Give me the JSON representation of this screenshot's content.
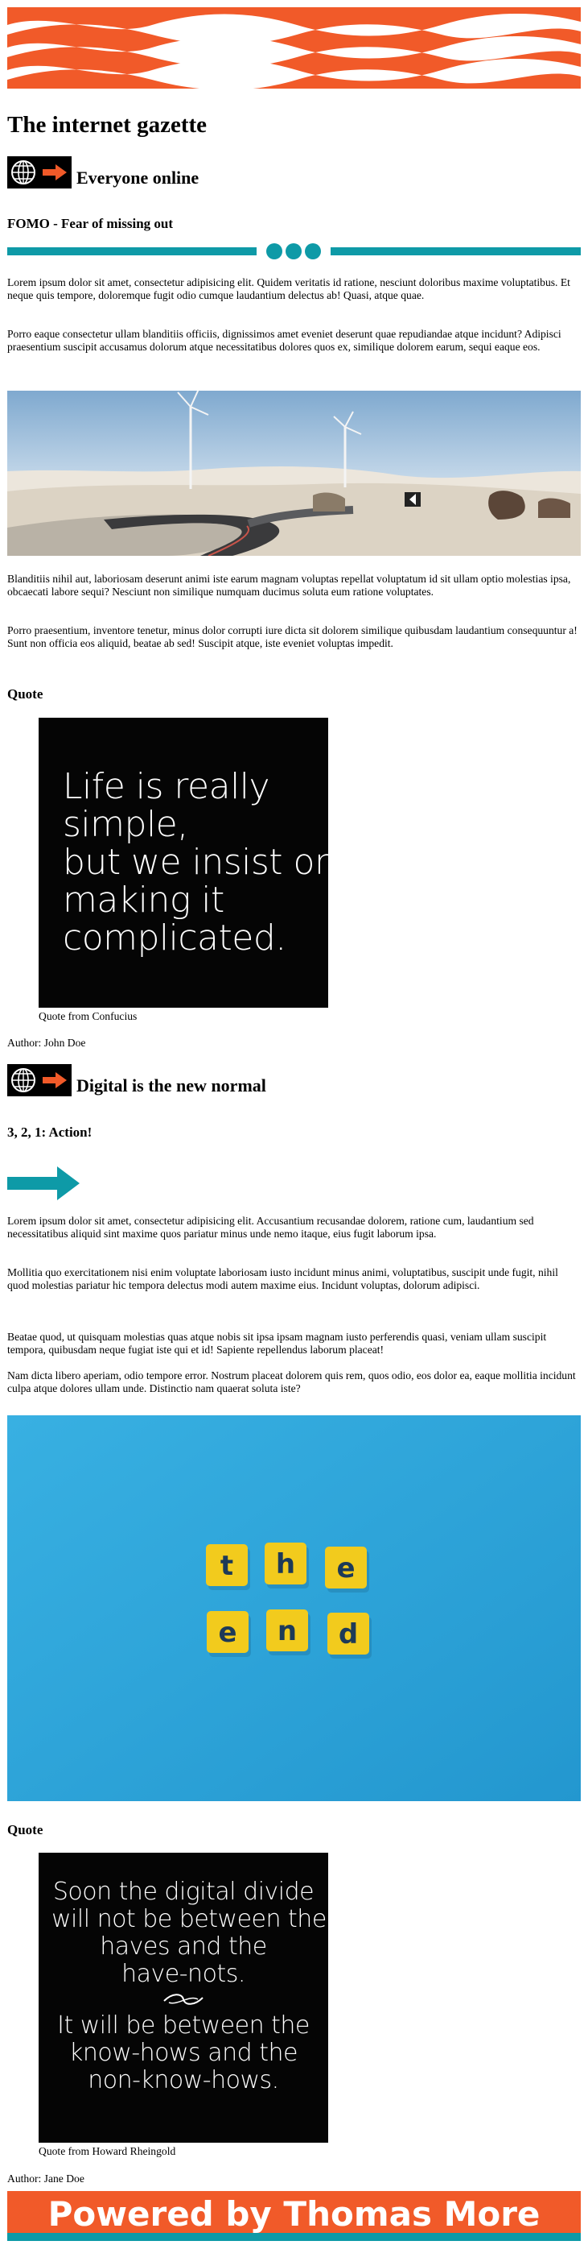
{
  "site": {
    "title": "The internet gazette"
  },
  "colors": {
    "accent_orange": "#f15a29",
    "accent_teal": "#0e9aa7"
  },
  "sections": [
    {
      "icon": "globe-arrow-icon",
      "title": "Everyone online",
      "subtitle": "FOMO - Fear of missing out",
      "paragraphs_before": [
        "Lorem ipsum dolor sit amet, consectetur adipisicing elit. Quidem veritatis id ratione, nesciunt doloribus maxime voluptatibus. Et neque quis tempore, doloremque fugit odio cumque laudantium delectus ab! Quasi, atque quae.",
        "Porro eaque consectetur ullam blanditiis officiis, dignissimos amet eveniet deserunt quae repudiandae atque incidunt? Adipisci praesentium suscipit accusamus dolorum atque necessitatibus dolores quos ex, similique dolorem earum, sequi eaque eos."
      ],
      "paragraphs_after": [
        "Blanditiis nihil aut, laboriosam deserunt animi iste earum magnam voluptas repellat voluptatum id sit ullam optio molestias ipsa, obcaecati labore sequi? Nesciunt non similique numquam ducimus soluta eum ratione voluptates.",
        "Porro praesentium, inventore tenetur, minus dolor corrupti iure dicta sit dolorem similique quibusdam laudantium consequuntur a! Sunt non officia eos aliquid, beatae ab sed! Suscipit atque, iste eveniet voluptas impedit."
      ],
      "quote": {
        "heading": "Quote",
        "lines": [
          "Life is really",
          "simple,",
          "but we insist on",
          "making it",
          "complicated."
        ],
        "caption": "Quote from Confucius",
        "author": "Author: John Doe"
      }
    },
    {
      "icon": "globe-arrow-icon",
      "title": "Digital is the new normal",
      "subtitle": "3, 2, 1: Action!",
      "paragraphs_before": [
        "Lorem ipsum dolor sit amet, consectetur adipisicing elit. Accusantium recusandae dolorem, ratione cum, laudantium sed necessitatibus aliquid sint maxime quos pariatur minus unde nemo itaque, eius fugit laborum ipsa.",
        "Mollitia quo exercitationem nisi enim voluptate laboriosam iusto incidunt minus animi, voluptatibus, suscipit unde fugit, nihil quod molestias pariatur hic tempora delectus modi autem maxime eius. Incidunt voluptas, dolorum adipisci.",
        "Beatae quod, ut quisquam molestias quas atque nobis sit ipsa ipsam magnam iusto perferendis quasi, veniam ullam suscipit tempora, quibusdam neque fugiat iste qui et id! Sapiente repellendus laborum placeat!",
        "Nam dicta libero aperiam, odio tempore error. Nostrum placeat dolorem quis rem, quos odio, eos dolor ea, eaque mollitia incidunt culpa atque dolores ullam unde. Distinctio nam quaerat soluta iste?"
      ],
      "tiles_row1": [
        "t",
        "h",
        "e"
      ],
      "tiles_row2": [
        "e",
        "n",
        "d"
      ],
      "quote": {
        "heading": "Quote",
        "lines_top": [
          "Soon the digital divide",
          "will not be between the",
          "haves and the",
          "have-nots."
        ],
        "lines_bottom": [
          "It will be between the",
          "know-hows and the",
          "non-know-hows."
        ],
        "caption": "Quote from Howard Rheingold",
        "author": "Author: Jane Doe"
      }
    }
  ],
  "footer": {
    "text": "Powered by Thomas More"
  }
}
